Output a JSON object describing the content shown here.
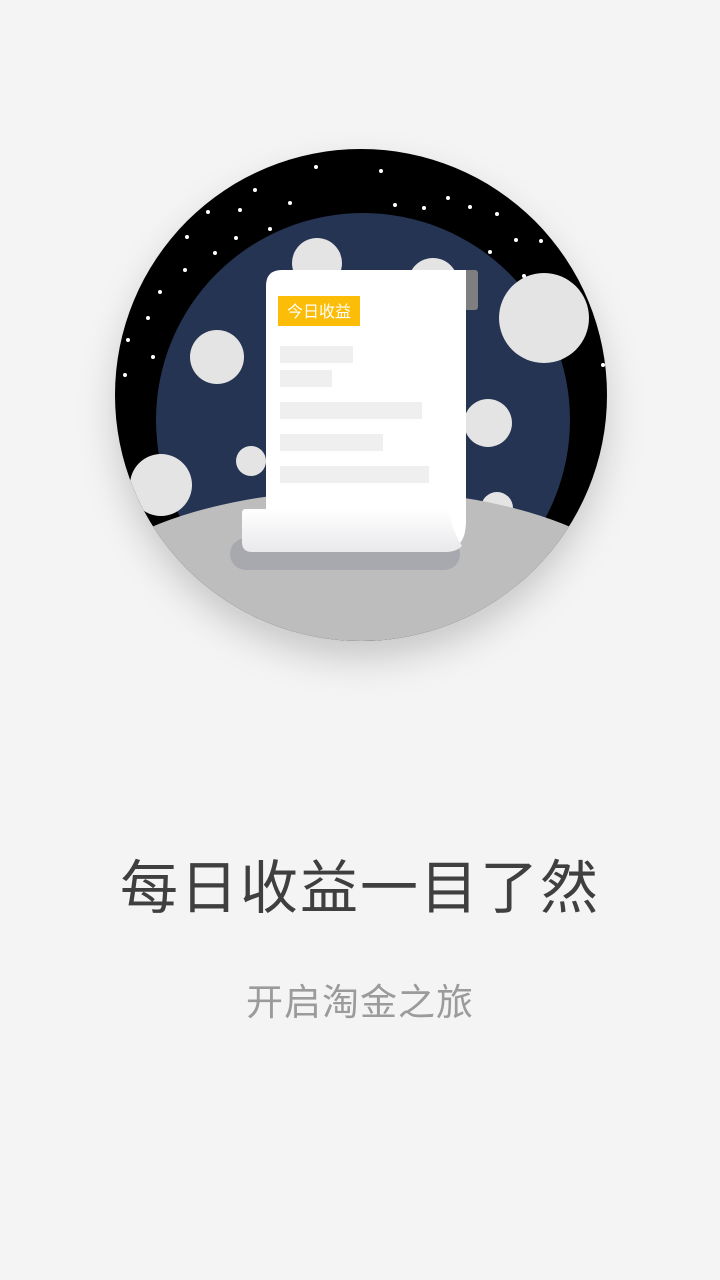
{
  "illustration": {
    "badge_label": "今日收益",
    "badge_color": "#fbbd08",
    "space_color": "#000000",
    "planet_color": "#253453",
    "ground_color": "#bdbdbd",
    "crater_color": "#e4e4e4"
  },
  "onboarding": {
    "title": "每日收益一目了然",
    "subtitle": "开启淘金之旅"
  }
}
